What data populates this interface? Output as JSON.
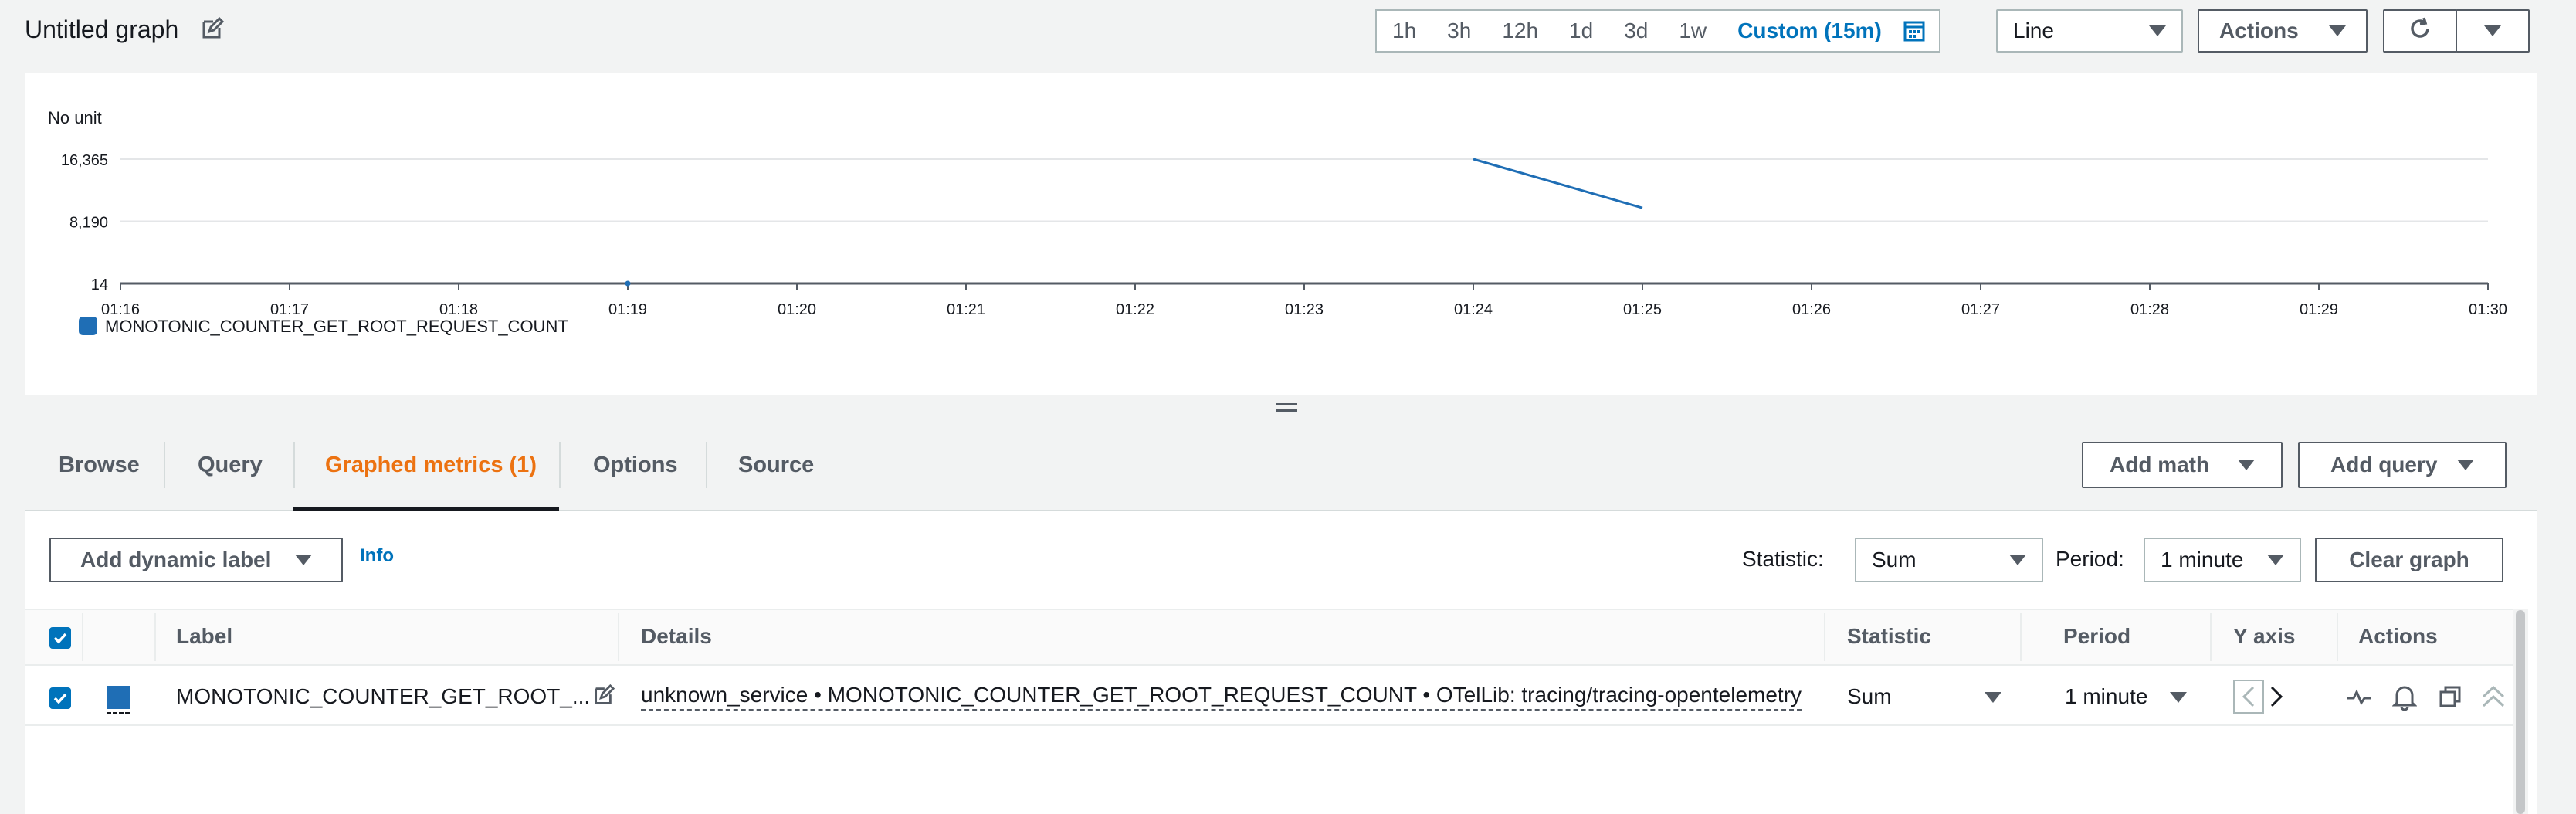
{
  "header": {
    "title": "Untitled graph",
    "time_ranges": [
      "1h",
      "3h",
      "12h",
      "1d",
      "3d",
      "1w"
    ],
    "custom_range": "Custom (15m)",
    "chart_type": "Line",
    "actions_label": "Actions"
  },
  "chart_data": {
    "type": "line",
    "unit_label": "No unit",
    "yticks": [
      "16,365",
      "8,190",
      "14"
    ],
    "ylim": [
      14,
      16365
    ],
    "xticks": [
      "01:16",
      "01:17",
      "01:18",
      "01:19",
      "01:20",
      "01:21",
      "01:22",
      "01:23",
      "01:24",
      "01:25",
      "01:26",
      "01:27",
      "01:28",
      "01:29",
      "01:30"
    ],
    "series": [
      {
        "name": "MONOTONIC_COUNTER_GET_ROOT_REQUEST_COUNT",
        "color": "#1f6eb5",
        "points": [
          {
            "x": "01:19",
            "y": 14
          },
          {
            "x": "01:24",
            "y": 16365
          },
          {
            "x": "01:25",
            "y": 9950
          }
        ]
      }
    ]
  },
  "tabs": {
    "items": [
      "Browse",
      "Query",
      "Graphed metrics (1)",
      "Options",
      "Source"
    ],
    "active_index": 2,
    "add_math": "Add math",
    "add_query": "Add query"
  },
  "metrics": {
    "add_dynamic_label": "Add dynamic label",
    "info": "Info",
    "statistic_label": "Statistic:",
    "statistic_value": "Sum",
    "period_label": "Period:",
    "period_value": "1 minute",
    "clear_graph": "Clear graph",
    "columns": [
      "Label",
      "Details",
      "Statistic",
      "Period",
      "Y axis",
      "Actions"
    ],
    "rows": [
      {
        "label": "MONOTONIC_COUNTER_GET_ROOT_...",
        "details": "unknown_service • MONOTONIC_COUNTER_GET_ROOT_REQUEST_COUNT • OTelLib: tracing/tracing-opentelemetry",
        "statistic": "Sum",
        "period": "1 minute",
        "color": "#1f6eb5",
        "checked": true
      }
    ]
  },
  "colors": {
    "accent": "#0073bb",
    "active_tab": "#ec7211",
    "series": "#1f6eb5"
  }
}
